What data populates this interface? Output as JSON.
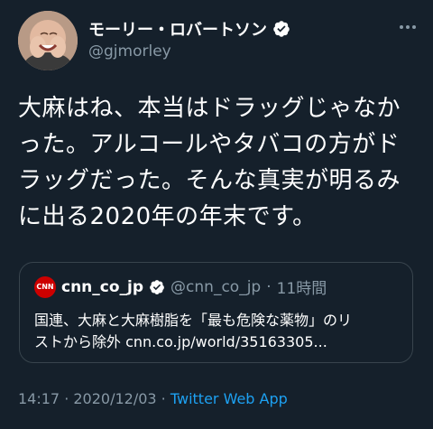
{
  "author": {
    "display_name": "モーリー・ロバートソン",
    "handle": "@gjmorley",
    "verified": true
  },
  "tweet": {
    "lines": [
      "大麻はね、本当はドラッグじゃなか",
      "った。アルコールやタバコの方がド",
      "ラッグだった。そんな真実が明るみ",
      "に出る2020年の年末です。"
    ]
  },
  "quoted": {
    "avatar_text": "CNN",
    "display_name": "cnn_co_jp",
    "handle": "@cnn_co_jp",
    "separator": "·",
    "time": "11時間",
    "lines": [
      "国連、大麻と大麻樹脂を「最も危険な薬物」のリ",
      "ストから除外 cnn.co.jp/world/35163305..."
    ]
  },
  "meta": {
    "time": "14:17",
    "sep1": " · ",
    "date": "2020/12/03",
    "sep2": " · ",
    "app": "Twitter Web App"
  },
  "colors": {
    "background": "#15202b",
    "secondary_text": "#8899a6",
    "link": "#1da1f2",
    "border": "#38444d",
    "cnn_red": "#cc0000"
  },
  "icons": {
    "verified": "verified-badge-icon",
    "more": "more-icon"
  }
}
